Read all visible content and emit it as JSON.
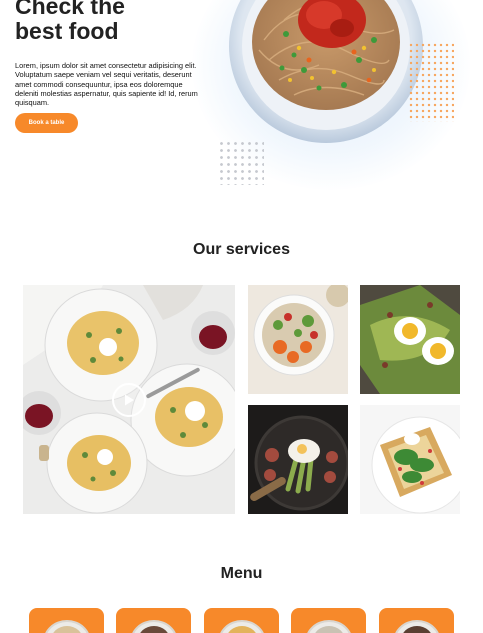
{
  "hero": {
    "title_line1": "Check the",
    "title_line2": "best food",
    "description": "Lorem, ipsum dolor sit amet consectetur adipisicing elit. Voluptatum saepe veniam vel sequi veritatis, deserunt amet commodi consequuntur, ipsa eos doloremque deleniti molestias aspernatur, quis sapiente id! Id, rerum quisquam.",
    "cta_label": "Book a table"
  },
  "services": {
    "title": "Our services",
    "images": [
      {
        "icon": "pasta-dinner-photo"
      },
      {
        "icon": "salad-bowl-photo"
      },
      {
        "icon": "avocado-toast-photo"
      },
      {
        "icon": "asparagus-skillet-photo"
      },
      {
        "icon": "spinach-toast-photo"
      }
    ]
  },
  "menu": {
    "title": "Menu",
    "cards": 5
  },
  "colors": {
    "accent": "#f7892a",
    "heading": "#222222"
  }
}
